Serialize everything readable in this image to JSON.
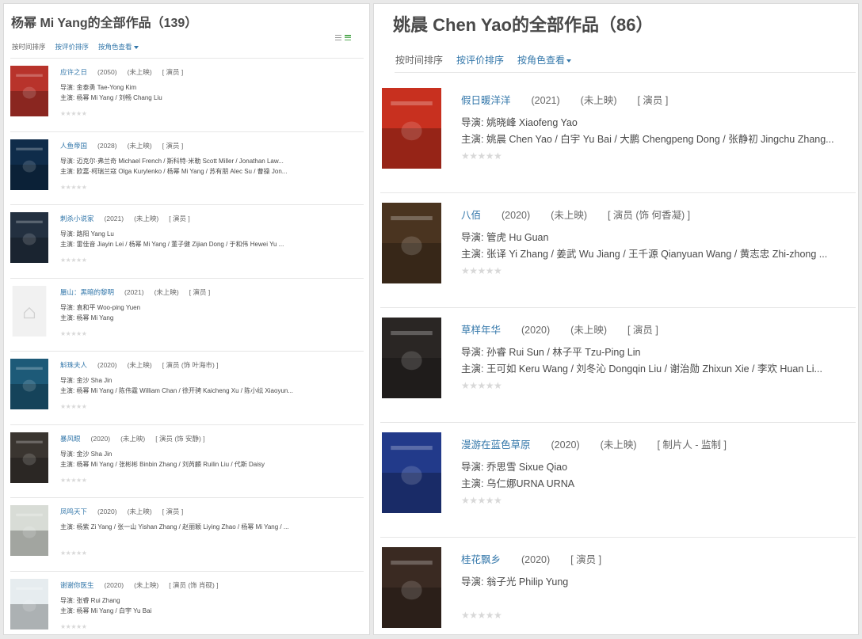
{
  "left": {
    "title": "杨幂 Mi Yang的全部作品（139）",
    "sort": [
      {
        "label": "按时间排序"
      },
      {
        "label": "按评价排序"
      },
      {
        "label": "按角色查看"
      }
    ],
    "view_icons": [
      "list-view-icon",
      "grid-view-icon"
    ],
    "items": [
      {
        "title": "应许之日",
        "year": "(2050)",
        "status": "(未上映)",
        "role": "[ 演员 ]",
        "director": "导演: 金泰勇 Tae-Yong Kim",
        "cast": "主演: 杨幂 Mi Yang / 刘畅 Chang Liu",
        "stars": "★★★★★",
        "poster_color": "#b8332b"
      },
      {
        "title": "人鱼帝国",
        "year": "(2028)",
        "status": "(未上映)",
        "role": "[ 演员 ]",
        "director": "导演: 迈克尔·弗兰奇 Michael French / 斯科特·米勒 Scott Miller / Jonathan Law...",
        "cast": "主演: 欧嘉·柯瑞兰寇 Olga Kurylenko / 杨幂 Mi Yang / 苏有朋 Alec Su / 曹操 Jon...",
        "stars": "★★★★★",
        "poster_color": "#0f2c4a"
      },
      {
        "title": "刺杀小说家",
        "year": "(2021)",
        "status": "(未上映)",
        "role": "[ 演员 ]",
        "director": "导演: 路阳 Yang Lu",
        "cast": "主演: 雷佳音 Jiayin Lei / 杨幂 Mi Yang / 董子健 Zijian Dong / 于和伟 Hewei Yu ...",
        "stars": "★★★★★",
        "poster_color": "#233040"
      },
      {
        "title": "蜃山：黑暗的黎明",
        "year": "(2021)",
        "status": "(未上映)",
        "role": "[ 演员 ]",
        "director": "导演: 袁和平 Woo-ping Yuen",
        "cast": "主演: 杨幂 Mi Yang",
        "stars": "★★★★★",
        "poster_color": "#f1f1f1"
      },
      {
        "title": "斛珠夫人",
        "year": "(2020)",
        "status": "(未上映)",
        "role": "[ 演员 (饰 叶海市) ]",
        "director": "导演: 金沙 Sha Jin",
        "cast": "主演: 杨幂 Mi Yang / 陈伟霆 William Chan / 徐开骋 Kaicheng Xu / 陈小纭 Xiaoyun...",
        "stars": "★★★★★",
        "poster_color": "#1d5a78"
      },
      {
        "title": "暴风眼",
        "year": "(2020)",
        "status": "(未上映)",
        "role": "[ 演员 (饰 安静) ]",
        "director": "导演: 金沙 Sha Jin",
        "cast": "主演: 杨幂 Mi Yang / 张彬彬 Binbin Zhang / 刘芮麟 Ruilin Liu / 代斯 Daisy",
        "stars": "★★★★★",
        "poster_color": "#3a3530"
      },
      {
        "title": "凤鸣天下",
        "year": "(2020)",
        "status": "(未上映)",
        "role": "[ 演员 ]",
        "director": "",
        "cast": "主演: 杨紫 Zi Yang / 张一山 Yishan Zhang / 赵丽颖 Liying Zhao / 杨幂 Mi Yang / ...",
        "stars": "★★★★★",
        "poster_color": "#d8dcd6"
      },
      {
        "title": "谢谢你医生",
        "year": "(2020)",
        "status": "(未上映)",
        "role": "[ 演员 (饰 肖砚) ]",
        "director": "导演: 张睿 Rui Zhang",
        "cast": "主演: 杨幂 Mi Yang / 白宇 Yu Bai",
        "stars": "★★★★★",
        "poster_color": "#e6ecef"
      }
    ]
  },
  "right": {
    "title": "姚晨 Chen Yao的全部作品（86）",
    "sort": [
      {
        "label": "按时间排序"
      },
      {
        "label": "按评价排序"
      },
      {
        "label": "按角色查看"
      }
    ],
    "items": [
      {
        "title": "假日暖洋洋",
        "year": "(2021)",
        "status": "(未上映)",
        "role": "[ 演员 ]",
        "director": "导演: 姚晓峰 Xiaofeng Yao",
        "cast": "主演: 姚晨 Chen Yao / 白宇 Yu Bai / 大鹏 Chengpeng Dong / 张静初 Jingchu Zhang...",
        "stars": "★★★★★",
        "poster_color": "#c8301f"
      },
      {
        "title": "八佰",
        "year": "(2020)",
        "status": "(未上映)",
        "role": "[ 演员 (饰 何香凝) ]",
        "director": "导演: 管虎 Hu Guan",
        "cast": "主演: 张译 Yi Zhang / 姜武 Wu Jiang / 王千源 Qianyuan Wang / 黄志忠 Zhi-zhong ...",
        "stars": "★★★★★",
        "poster_color": "#4a3420"
      },
      {
        "title": "草样年华",
        "year": "(2020)",
        "status": "(未上映)",
        "role": "[ 演员 ]",
        "director": "导演: 孙睿 Rui Sun / 林子平 Tzu-Ping Lin",
        "cast": "主演: 王可如 Keru Wang / 刘冬沁 Dongqin Liu / 谢治勋 Zhixun Xie / 李欢 Huan Li...",
        "stars": "★★★★★",
        "poster_color": "#2a2624"
      },
      {
        "title": "漫游在蓝色草原",
        "year": "(2020)",
        "status": "(未上映)",
        "role": "[ 制片人 - 监制 ]",
        "director": "导演: 乔思雪 Sixue Qiao",
        "cast": "主演: 乌仁娜URNA URNA",
        "stars": "★★★★★",
        "poster_color": "#223a8a"
      },
      {
        "title": "桂花飘乡",
        "year": "(2020)",
        "status": "",
        "role": "[ 演员 ]",
        "director": "导演: 翁子光 Philip Yung",
        "cast": "",
        "stars": "★★★★★",
        "poster_color": "#3a2a22"
      }
    ]
  }
}
